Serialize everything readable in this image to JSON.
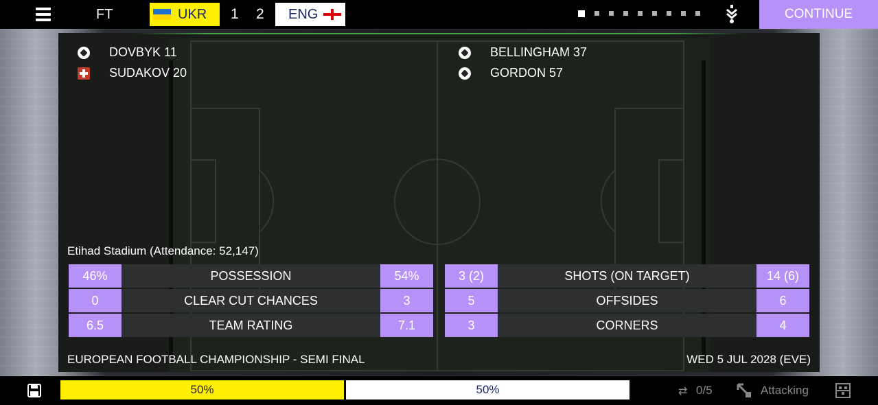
{
  "header": {
    "status": "FT",
    "home_team": "UKR",
    "away_team": "ENG",
    "home_score": "1",
    "away_score": "2",
    "page_indicator": {
      "total": 9,
      "current": 1
    },
    "continue_label": "CONTINUE"
  },
  "home_events": [
    {
      "icon": "goal-ball-icon",
      "text": "DOVBYK 11"
    },
    {
      "icon": "injury-icon",
      "text": "SUDAKOV 20"
    }
  ],
  "away_events": [
    {
      "icon": "goal-ball-icon",
      "text": "BELLINGHAM 37"
    },
    {
      "icon": "goal-ball-icon",
      "text": "GORDON 57"
    }
  ],
  "venue": "Etihad Stadium (Attendance: 52,147)",
  "stats_left": [
    {
      "home": "46%",
      "label": "POSSESSION",
      "away": "54%"
    },
    {
      "home": "0",
      "label": "CLEAR CUT CHANCES",
      "away": "3"
    },
    {
      "home": "6.5",
      "label": "TEAM RATING",
      "away": "7.1"
    }
  ],
  "stats_right": [
    {
      "home": "3 (2)",
      "label": "SHOTS (ON TARGET)",
      "away": "14 (6)"
    },
    {
      "home": "5",
      "label": "OFFSIDES",
      "away": "6"
    },
    {
      "home": "3",
      "label": "CORNERS",
      "away": "4"
    }
  ],
  "competition": "EUROPEAN FOOTBALL CHAMPIONSHIP - SEMI FINAL",
  "date": "WED 5 JUL 2028 (EVE)",
  "footer": {
    "home_mentality": "50%",
    "away_mentality": "50%",
    "subs": "0/5",
    "tactic": "Attacking"
  },
  "colors": {
    "accent": "#b692f8",
    "home": "#ffef00",
    "away": "#ffffff"
  }
}
